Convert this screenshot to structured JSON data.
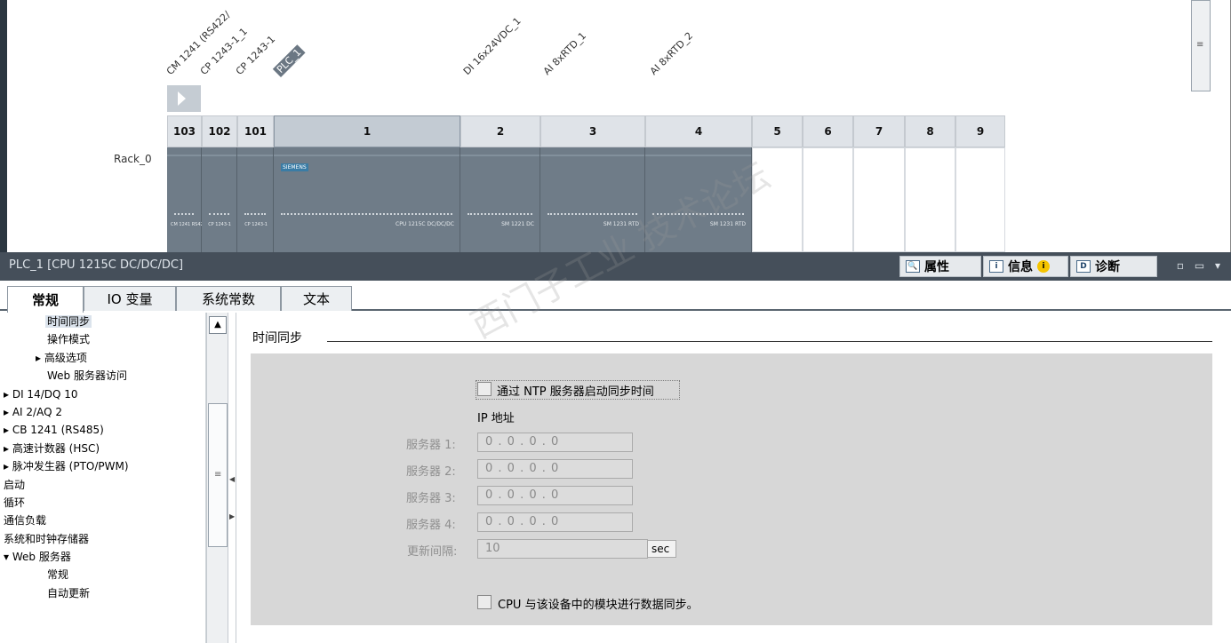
{
  "device_view": {
    "rack_name": "Rack_0",
    "module_labels": [
      "CM 1241 (RS422/",
      "CP 1243-1_1",
      "CP 1243-1",
      "PLC_1",
      "DI 16x24VDC_1",
      "AI 8xRTD_1",
      "AI 8xRTD_2"
    ],
    "slots": [
      "103",
      "102",
      "101",
      "1",
      "2",
      "3",
      "4",
      "5",
      "6",
      "7",
      "8",
      "9"
    ],
    "siemens_tag": "SIEMENS",
    "cpu_text": "CPU 1215C DC/DC/DC",
    "module_texts": [
      "CM 1241 RS422/485",
      "CP 1243-1",
      "CP 1243-1",
      "SM 1221 DC",
      "SM 1231 RTD",
      "SM 1231 RTD"
    ]
  },
  "panel": {
    "title": "PLC_1 [CPU 1215C DC/DC/DC]",
    "right_tabs": {
      "properties": "属性",
      "info": "信息",
      "diagnostics": "诊断"
    },
    "window_controls": "▫ ▭ ▾"
  },
  "tabs": [
    "常规",
    "IO 变量",
    "系统常数",
    "文本"
  ],
  "tree": [
    {
      "label": "时间同步",
      "indent": 2,
      "selected": true
    },
    {
      "label": "操作模式",
      "indent": 2
    },
    {
      "label": "▸ 高级选项",
      "indent": 1
    },
    {
      "label": "Web 服务器访问",
      "indent": 2
    },
    {
      "label": "▸ DI 14/DQ 10",
      "indent": 0
    },
    {
      "label": "▸ AI 2/AQ 2",
      "indent": 0
    },
    {
      "label": "▸ CB 1241 (RS485)",
      "indent": 0
    },
    {
      "label": "▸ 高速计数器 (HSC)",
      "indent": 0
    },
    {
      "label": "▸ 脉冲发生器 (PTO/PWM)",
      "indent": 0
    },
    {
      "label": "启动",
      "indent": 0
    },
    {
      "label": "循环",
      "indent": 0
    },
    {
      "label": "通信负载",
      "indent": 0
    },
    {
      "label": "系统和时钟存储器",
      "indent": 0
    },
    {
      "label": "▾ Web 服务器",
      "indent": 0
    },
    {
      "label": "常规",
      "indent": 2
    },
    {
      "label": "自动更新",
      "indent": 2
    }
  ],
  "content": {
    "section_title": "时间同步",
    "ntp_checkbox_label": "通过 NTP 服务器启动同步时间",
    "ip_header": "IP 地址",
    "servers": [
      {
        "label": "服务器 1:",
        "value": "0 . 0 . 0 . 0"
      },
      {
        "label": "服务器 2:",
        "value": "0 . 0 . 0 . 0"
      },
      {
        "label": "服务器 3:",
        "value": "0 . 0 . 0 . 0"
      },
      {
        "label": "服务器 4:",
        "value": "0 . 0 . 0 . 0"
      }
    ],
    "update_interval_label": "更新间隔:",
    "update_interval_value": "10",
    "update_interval_unit": "sec",
    "cpu_sync_label": "CPU 与该设备中的模块进行数据同步。"
  },
  "watermark": "西门子工业 技术论坛"
}
